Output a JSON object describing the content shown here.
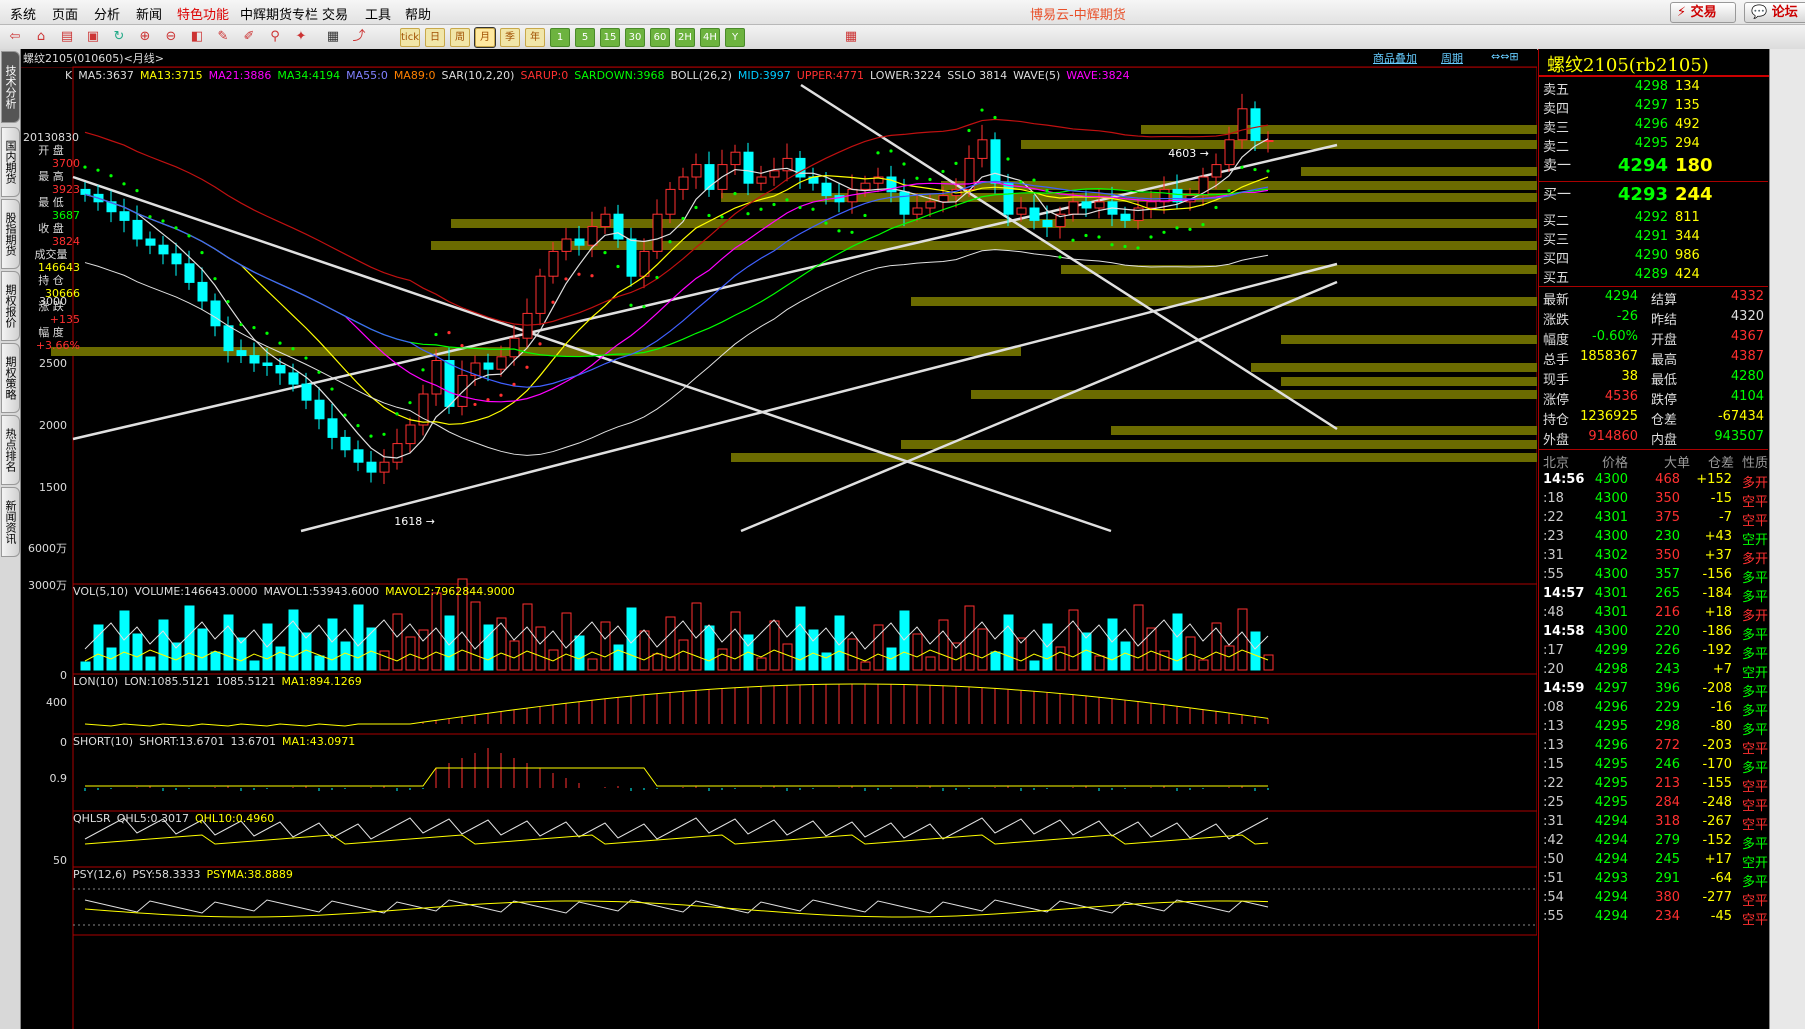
{
  "menu": [
    "系统",
    "页面",
    "分析",
    "新闻",
    "特色功能",
    "中辉期货专栏",
    "交易",
    "工具",
    "帮助"
  ],
  "menu_active": "特色功能",
  "app_title": "博易云-中辉期货",
  "top_buttons": {
    "trade": "交易",
    "forum": "论坛"
  },
  "toolbar_labels": [
    "tick",
    "日",
    "周",
    "月",
    "季",
    "年",
    "1",
    "5",
    "15",
    "30",
    "60",
    "2H",
    "4H",
    "Y"
  ],
  "left_tabs": [
    "技术分析",
    "国内期货",
    "股指期货",
    "期权报价",
    "期权策略",
    "热点排名",
    "新闻资讯"
  ],
  "chart": {
    "title": "螺纹2105(010605)<月线>",
    "links": [
      "商品叠加",
      "周期"
    ],
    "ma_line": [
      {
        "text": "K",
        "color": "#dddddd"
      },
      {
        "text": "MA5:3637",
        "color": "#dddddd"
      },
      {
        "text": "MA13:3715",
        "color": "#ffff00"
      },
      {
        "text": "MA21:3886",
        "color": "#ff00ff"
      },
      {
        "text": "MA34:4194",
        "color": "#00ff00"
      },
      {
        "text": "MA55:0",
        "color": "#8080ff"
      },
      {
        "text": "MA89:0",
        "color": "#ff8000"
      },
      {
        "text": "SAR(10,2,20)",
        "color": "#dddddd"
      },
      {
        "text": "SARUP:0",
        "color": "#ff3030"
      },
      {
        "text": "SARDOWN:3968",
        "color": "#00ff00"
      },
      {
        "text": "BOLL(26,2)",
        "color": "#dddddd"
      },
      {
        "text": "MID:3997",
        "color": "#00ccff"
      },
      {
        "text": "UPPER:4771",
        "color": "#ff3030"
      },
      {
        "text": "LOWER:3224",
        "color": "#dddddd"
      },
      {
        "text": "SSLO 3814",
        "color": "#dddddd"
      },
      {
        "text": "WAVE(5)",
        "color": "#dddddd"
      },
      {
        "text": "WAVE:3824",
        "color": "#ff00ff"
      }
    ],
    "info_box": {
      "date": "20130830",
      "labels": [
        "开 盘",
        "最 高",
        "最 低",
        "收 盘",
        "成交量",
        "持 仓",
        "涨 跌",
        "幅 度"
      ],
      "values": [
        "3700",
        "3923",
        "3687",
        "3824",
        "146643",
        "30666",
        "+135",
        "+3.66%"
      ],
      "value_colors": [
        "#ff3030",
        "#ff3030",
        "#00ff00",
        "#ff3030",
        "#ffff00",
        "#ffff00",
        "#ff3030",
        "#ff3030"
      ]
    },
    "price_axis": [
      "3000",
      "2500",
      "2000",
      "1500"
    ],
    "price_marks": {
      "high_label": "4603",
      "low_label": "1618"
    },
    "vol_label": [
      {
        "text": "VOL(5,10)",
        "color": "#dddddd"
      },
      {
        "text": "VOLUME:146643.0000",
        "color": "#dddddd"
      },
      {
        "text": "MAVOL1:53943.6000",
        "color": "#dddddd"
      },
      {
        "text": "MAVOL2:7962844.9000",
        "color": "#ffff00"
      }
    ],
    "vol_axis": [
      "6000万",
      "3000万"
    ],
    "lon_label": [
      {
        "text": "LON(10)",
        "color": "#dddddd"
      },
      {
        "text": "LON:1085.5121",
        "color": "#dddddd"
      },
      {
        "text": "1085.5121",
        "color": "#dddddd"
      },
      {
        "text": "MA1:894.1269",
        "color": "#ffff00"
      }
    ],
    "lon_axis": [
      "0"
    ],
    "short_label": [
      {
        "text": "SHORT(10)",
        "color": "#dddddd"
      },
      {
        "text": "SHORT:13.6701",
        "color": "#dddddd"
      },
      {
        "text": "13.6701",
        "color": "#dddddd"
      },
      {
        "text": "MA1:43.0971",
        "color": "#ffff00"
      }
    ],
    "short_axis": [
      "400",
      "0"
    ],
    "qhlsr_label": [
      {
        "text": "QHLSR",
        "color": "#dddddd"
      },
      {
        "text": "QHL5:0.3017",
        "color": "#dddddd"
      },
      {
        "text": "QHL10:0.4960",
        "color": "#ffff00"
      }
    ],
    "qhlsr_axis": [
      "0.9"
    ],
    "psy_label": [
      {
        "text": "PSY(12,6)",
        "color": "#dddddd"
      },
      {
        "text": "PSY:58.3333",
        "color": "#dddddd"
      },
      {
        "text": "PSYMA:38.8889",
        "color": "#ffff00"
      }
    ],
    "psy_axis": [
      "50"
    ]
  },
  "quote": {
    "title": "螺纹2105(rb2105)",
    "asks": [
      {
        "label": "卖五",
        "price": "4298",
        "vol": "134"
      },
      {
        "label": "卖四",
        "price": "4297",
        "vol": "135"
      },
      {
        "label": "卖三",
        "price": "4296",
        "vol": "492"
      },
      {
        "label": "卖二",
        "price": "4295",
        "vol": "294"
      },
      {
        "label": "卖一",
        "price": "4294",
        "vol": "180"
      }
    ],
    "bids": [
      {
        "label": "买一",
        "price": "4293",
        "vol": "244"
      },
      {
        "label": "买二",
        "price": "4292",
        "vol": "811"
      },
      {
        "label": "买三",
        "price": "4291",
        "vol": "344"
      },
      {
        "label": "买四",
        "price": "4290",
        "vol": "986"
      },
      {
        "label": "买五",
        "price": "4289",
        "vol": "424"
      }
    ],
    "stats": [
      {
        "l1": "最新",
        "v1": "4294",
        "c1": "#00ff00",
        "l2": "结算",
        "v2": "4332",
        "c2": "#ff3030"
      },
      {
        "l1": "涨跌",
        "v1": "-26",
        "c1": "#00ff00",
        "l2": "昨结",
        "v2": "4320",
        "c2": "#dddddd"
      },
      {
        "l1": "幅度",
        "v1": "-0.60%",
        "c1": "#00ff00",
        "l2": "开盘",
        "v2": "4367",
        "c2": "#ff3030"
      },
      {
        "l1": "总手",
        "v1": "1858367",
        "c1": "#ffff00",
        "l2": "最高",
        "v2": "4387",
        "c2": "#ff3030"
      },
      {
        "l1": "现手",
        "v1": "38",
        "c1": "#ffff00",
        "l2": "最低",
        "v2": "4280",
        "c2": "#00ff00"
      },
      {
        "l1": "涨停",
        "v1": "4536",
        "c1": "#ff3030",
        "l2": "跌停",
        "v2": "4104",
        "c2": "#00ff00"
      },
      {
        "l1": "持仓",
        "v1": "1236925",
        "c1": "#ffff00",
        "l2": "仓差",
        "v2": "-67434",
        "c2": "#ffff00"
      },
      {
        "l1": "外盘",
        "v1": "914860",
        "c1": "#ff3030",
        "l2": "内盘",
        "v2": "943507",
        "c2": "#00ff00"
      }
    ],
    "tick_header": [
      "北京",
      "价格",
      "大单",
      "仓差",
      "性质"
    ],
    "ticks": [
      {
        "t": "14:56",
        "p": "4300",
        "v": "468",
        "vc": "#ff3030",
        "d": "+152",
        "n": "多开",
        "nc": "#ff3030"
      },
      {
        "t": ":18",
        "p": "4300",
        "v": "350",
        "vc": "#ff3030",
        "d": "-15",
        "n": "空平",
        "nc": "#ff3030"
      },
      {
        "t": ":22",
        "p": "4301",
        "v": "375",
        "vc": "#ff3030",
        "d": "-7",
        "n": "空平",
        "nc": "#ff3030"
      },
      {
        "t": ":23",
        "p": "4300",
        "v": "230",
        "vc": "#00ff00",
        "d": "+43",
        "n": "空开",
        "nc": "#00ff00"
      },
      {
        "t": ":31",
        "p": "4302",
        "v": "350",
        "vc": "#ff3030",
        "d": "+37",
        "n": "多开",
        "nc": "#ff3030"
      },
      {
        "t": ":55",
        "p": "4300",
        "v": "357",
        "vc": "#00ff00",
        "d": "-156",
        "n": "多平",
        "nc": "#00ff00"
      },
      {
        "t": "14:57",
        "p": "4301",
        "v": "265",
        "vc": "#00ff00",
        "d": "-184",
        "n": "多平",
        "nc": "#00ff00"
      },
      {
        "t": ":48",
        "p": "4301",
        "v": "216",
        "vc": "#ff3030",
        "d": "+18",
        "n": "多开",
        "nc": "#ff3030"
      },
      {
        "t": "14:58",
        "p": "4300",
        "v": "220",
        "vc": "#00ff00",
        "d": "-186",
        "n": "多平",
        "nc": "#00ff00"
      },
      {
        "t": ":17",
        "p": "4299",
        "v": "226",
        "vc": "#00ff00",
        "d": "-192",
        "n": "多平",
        "nc": "#00ff00"
      },
      {
        "t": ":20",
        "p": "4298",
        "v": "243",
        "vc": "#00ff00",
        "d": "+7",
        "n": "空开",
        "nc": "#00ff00"
      },
      {
        "t": "14:59",
        "p": "4297",
        "v": "396",
        "vc": "#00ff00",
        "d": "-208",
        "n": "多平",
        "nc": "#00ff00"
      },
      {
        "t": ":08",
        "p": "4296",
        "v": "229",
        "vc": "#00ff00",
        "d": "-16",
        "n": "多平",
        "nc": "#00ff00"
      },
      {
        "t": ":13",
        "p": "4295",
        "v": "298",
        "vc": "#00ff00",
        "d": "-80",
        "n": "多平",
        "nc": "#00ff00"
      },
      {
        "t": ":13",
        "p": "4296",
        "v": "272",
        "vc": "#ff3030",
        "d": "-203",
        "n": "空平",
        "nc": "#ff3030"
      },
      {
        "t": ":15",
        "p": "4295",
        "v": "246",
        "vc": "#00ff00",
        "d": "-170",
        "n": "多平",
        "nc": "#00ff00"
      },
      {
        "t": ":22",
        "p": "4295",
        "v": "213",
        "vc": "#ff3030",
        "d": "-155",
        "n": "空平",
        "nc": "#ff3030"
      },
      {
        "t": ":25",
        "p": "4295",
        "v": "284",
        "vc": "#ff3030",
        "d": "-248",
        "n": "空平",
        "nc": "#ff3030"
      },
      {
        "t": ":31",
        "p": "4294",
        "v": "318",
        "vc": "#ff3030",
        "d": "-267",
        "n": "空平",
        "nc": "#ff3030"
      },
      {
        "t": ":42",
        "p": "4294",
        "v": "279",
        "vc": "#00ff00",
        "d": "-152",
        "n": "多平",
        "nc": "#00ff00"
      },
      {
        "t": ":50",
        "p": "4294",
        "v": "245",
        "vc": "#00ff00",
        "d": "+17",
        "n": "空开",
        "nc": "#00ff00"
      },
      {
        "t": ":51",
        "p": "4293",
        "v": "291",
        "vc": "#00ff00",
        "d": "-64",
        "n": "多平",
        "nc": "#00ff00"
      },
      {
        "t": ":54",
        "p": "4294",
        "v": "380",
        "vc": "#ff3030",
        "d": "-277",
        "n": "空平",
        "nc": "#ff3030"
      },
      {
        "t": ":55",
        "p": "4294",
        "v": "234",
        "vc": "#ff3030",
        "d": "-45",
        "n": "空平",
        "nc": "#ff3030"
      }
    ]
  }
}
